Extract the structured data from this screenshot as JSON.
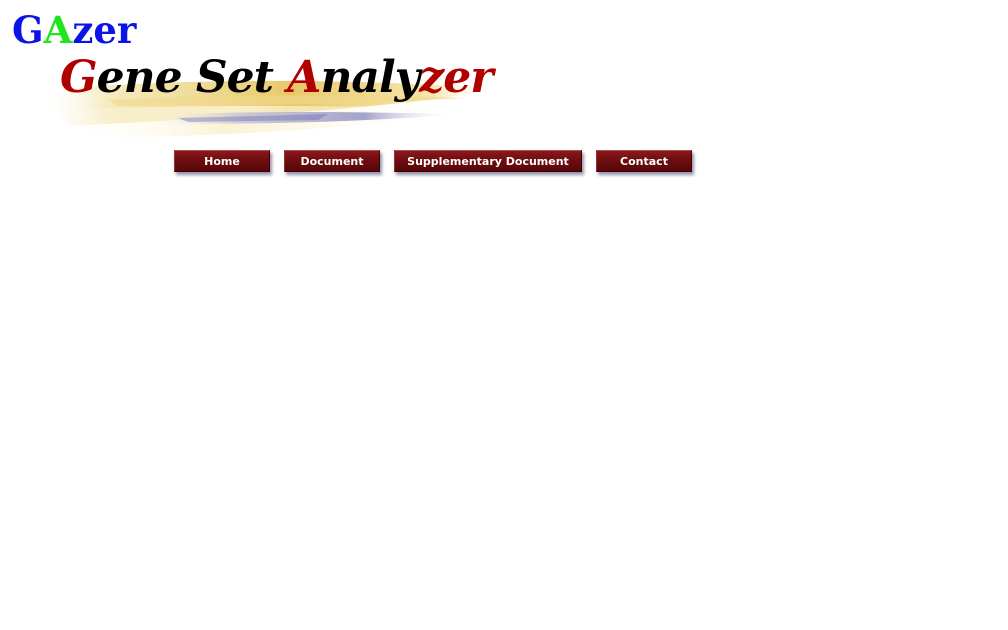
{
  "logo": {
    "letters": [
      {
        "char": "G",
        "color": "#0a14e6"
      },
      {
        "char": "A",
        "color": "#1ee61e"
      },
      {
        "char": "zer",
        "color": "#0a14e6"
      }
    ]
  },
  "banner": {
    "title_parts": [
      {
        "text": "G",
        "color": "#b00000"
      },
      {
        "text": "ene Set ",
        "color": "#000000"
      },
      {
        "text": "A",
        "color": "#b00000"
      },
      {
        "text": "naly",
        "color": "#000000"
      },
      {
        "text": "zer",
        "color": "#b00000"
      }
    ]
  },
  "nav": {
    "home": "Home",
    "document": "Document",
    "supplementary": "Supplementary Document",
    "contact": "Contact"
  }
}
